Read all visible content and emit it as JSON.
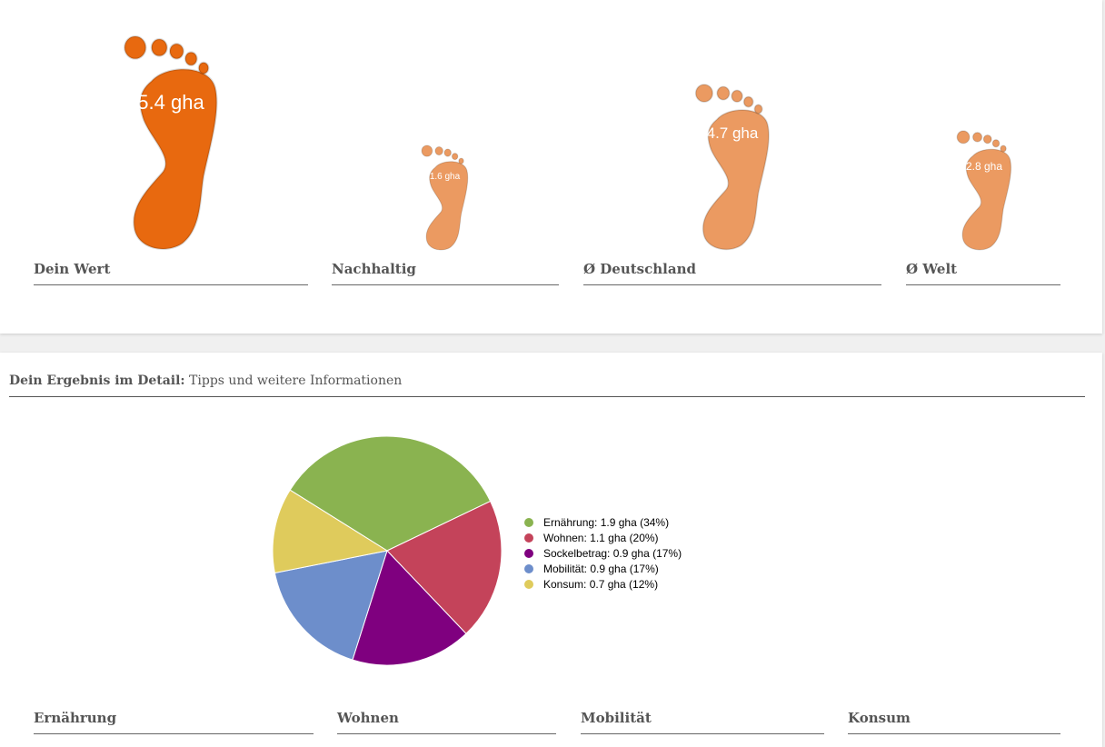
{
  "footprints": [
    {
      "id": "dein-wert",
      "label": "Dein Wert",
      "value_text": "5.4 gha",
      "value": 5.4,
      "color": "#E8690F"
    },
    {
      "id": "nachhaltig",
      "label": "Nachhaltig",
      "value_text": "1.6 gha",
      "value": 1.6,
      "color": "#EB9A61"
    },
    {
      "id": "deutschland",
      "label": "Ø Deutschland",
      "value_text": "4.7 gha",
      "value": 4.7,
      "color": "#EB9A61"
    },
    {
      "id": "welt",
      "label": "Ø Welt",
      "value_text": "2.8 gha",
      "value": 2.8,
      "color": "#EB9A61"
    }
  ],
  "detail": {
    "title_bold": "Dein Ergebnis im Detail:",
    "title_rest": " Tipps und weitere Informationen"
  },
  "chart_data": {
    "type": "pie",
    "slices": [
      {
        "label": "Ernährung: 1.9 gha (34%)",
        "value": 1.9,
        "percent": 34,
        "color": "#8AB350"
      },
      {
        "label": "Wohnen: 1.1 gha (20%)",
        "value": 1.1,
        "percent": 20,
        "color": "#C4435A"
      },
      {
        "label": "Sockelbetrag: 0.9 gha (17%)",
        "value": 0.9,
        "percent": 17,
        "color": "#7F007F"
      },
      {
        "label": "Mobilität: 0.9 gha (17%)",
        "value": 0.9,
        "percent": 17,
        "color": "#6D8ECB"
      },
      {
        "label": "Konsum: 0.7 gha (12%)",
        "value": 0.7,
        "percent": 12,
        "color": "#DFCB5C"
      }
    ],
    "legend_position": "right"
  },
  "categories": [
    "Ernährung",
    "Wohnen",
    "Mobilität",
    "Konsum"
  ]
}
